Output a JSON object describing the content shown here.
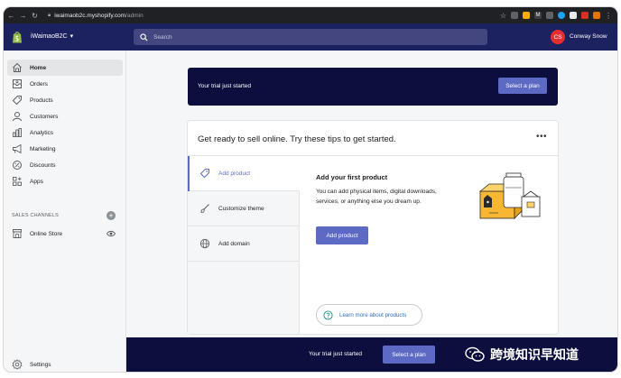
{
  "browser": {
    "url_host": "iwaimaob2c.myshopify.com",
    "url_path": "/admin"
  },
  "topbar": {
    "store_name": "iWaimaoB2C",
    "search_placeholder": "Search",
    "avatar_initials": "CS",
    "user_name": "Conway Snow"
  },
  "sidebar": {
    "items": [
      {
        "label": "Home",
        "icon": "home-icon"
      },
      {
        "label": "Orders",
        "icon": "orders-icon"
      },
      {
        "label": "Products",
        "icon": "tag-icon"
      },
      {
        "label": "Customers",
        "icon": "person-icon"
      },
      {
        "label": "Analytics",
        "icon": "bar-chart-icon"
      },
      {
        "label": "Marketing",
        "icon": "megaphone-icon"
      },
      {
        "label": "Discounts",
        "icon": "discount-icon"
      },
      {
        "label": "Apps",
        "icon": "apps-icon"
      }
    ],
    "sales_channels_label": "SALES CHANNELS",
    "online_store_label": "Online Store",
    "settings_label": "Settings"
  },
  "trial_banner": {
    "text": "Your trial just started",
    "button": "Select a plan"
  },
  "tips_card": {
    "title": "Get ready to sell online. Try these tips to get started.",
    "tabs": [
      {
        "label": "Add product",
        "icon": "tag-icon"
      },
      {
        "label": "Customize theme",
        "icon": "brush-icon"
      },
      {
        "label": "Add domain",
        "icon": "globe-icon"
      }
    ],
    "panel": {
      "title": "Add your first product",
      "description": "You can add physical items, digital downloads, services, or anything else you dream up.",
      "button": "Add product",
      "learn_more": "Learn more about products"
    }
  },
  "bottom_bar": {
    "text": "Your trial just started",
    "button": "Select a plan"
  },
  "watermark": {
    "text": "跨境知识早知道"
  },
  "colors": {
    "topbar": "#1c2260",
    "banner": "#0c0f3e",
    "accent": "#5c6ac4",
    "avatar": "#e32d30"
  }
}
